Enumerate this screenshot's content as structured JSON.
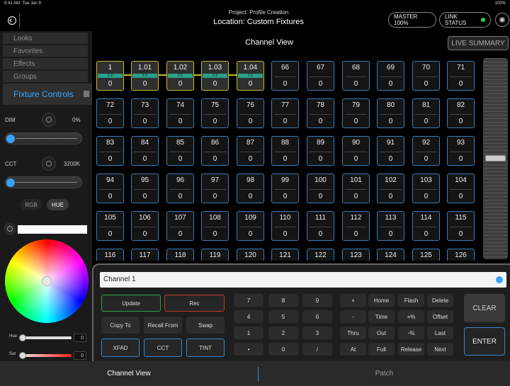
{
  "status_bar": {
    "time": "9:41 AM",
    "date": "Tue Jan 9",
    "battery": "100%"
  },
  "header": {
    "project": "Project: Profile Creation",
    "location": "Location: Custom Fixtures",
    "master": "MASTER 100%",
    "link_status": "LINK STATUS",
    "link_color": "#2ecc40"
  },
  "sidebar": {
    "tabs": [
      "Looks",
      "Favorites",
      "Effects",
      "Groups"
    ],
    "active_tab": "Fixture Controls",
    "dim": {
      "label": "DIM",
      "value": "0%"
    },
    "cct": {
      "label": "CCT",
      "value": "3200K"
    },
    "color_modes": [
      "RGB",
      "HUE"
    ],
    "hue": {
      "label": "Hue",
      "value": "0"
    },
    "sat": {
      "label": "Sat",
      "value": "0"
    }
  },
  "main": {
    "title": "Channel View",
    "live_summary": "LIVE SUMMARY",
    "selected_color": "#c9b82a",
    "channels": [
      [
        "1",
        "1.01",
        "1.02",
        "1.03",
        "1.04",
        "66",
        "67",
        "68",
        "69",
        "70",
        "71"
      ],
      [
        "72",
        "73",
        "74",
        "75",
        "76",
        "77",
        "78",
        "79",
        "80",
        "81",
        "82"
      ],
      [
        "83",
        "84",
        "85",
        "86",
        "87",
        "88",
        "89",
        "90",
        "91",
        "92",
        "93"
      ],
      [
        "94",
        "95",
        "96",
        "97",
        "98",
        "99",
        "100",
        "101",
        "102",
        "103",
        "104"
      ],
      [
        "105",
        "106",
        "107",
        "108",
        "109",
        "110",
        "111",
        "112",
        "113",
        "114",
        "115"
      ],
      [
        "116",
        "117",
        "118",
        "119",
        "120",
        "121",
        "122",
        "123",
        "124",
        "125",
        "126"
      ]
    ],
    "level": "0",
    "part_tag": "2.2"
  },
  "command": {
    "line": "Channel 1",
    "buttons": {
      "update": "Update",
      "rec": "Rec",
      "copy_to": "Copy To",
      "recall_from": "Recall From",
      "swap": "Swap",
      "xfad": "XFAD",
      "cct": "CCT",
      "tint": "TINT"
    },
    "keypad": [
      "7",
      "8",
      "9",
      "4",
      "5",
      "6",
      "1",
      "2",
      "3",
      "•",
      "0",
      "/"
    ],
    "ops": [
      "+",
      "Home",
      "Flash",
      "Delete",
      "-",
      "Time",
      "+%",
      "Offset",
      "Thru",
      "Out",
      "-%",
      "Last",
      "At",
      "Full",
      "Release",
      "Next"
    ],
    "clear": "CLEAR",
    "enter": "ENTER"
  },
  "bottom_tabs": {
    "channel_view": "Channel View",
    "patch": "Patch"
  }
}
